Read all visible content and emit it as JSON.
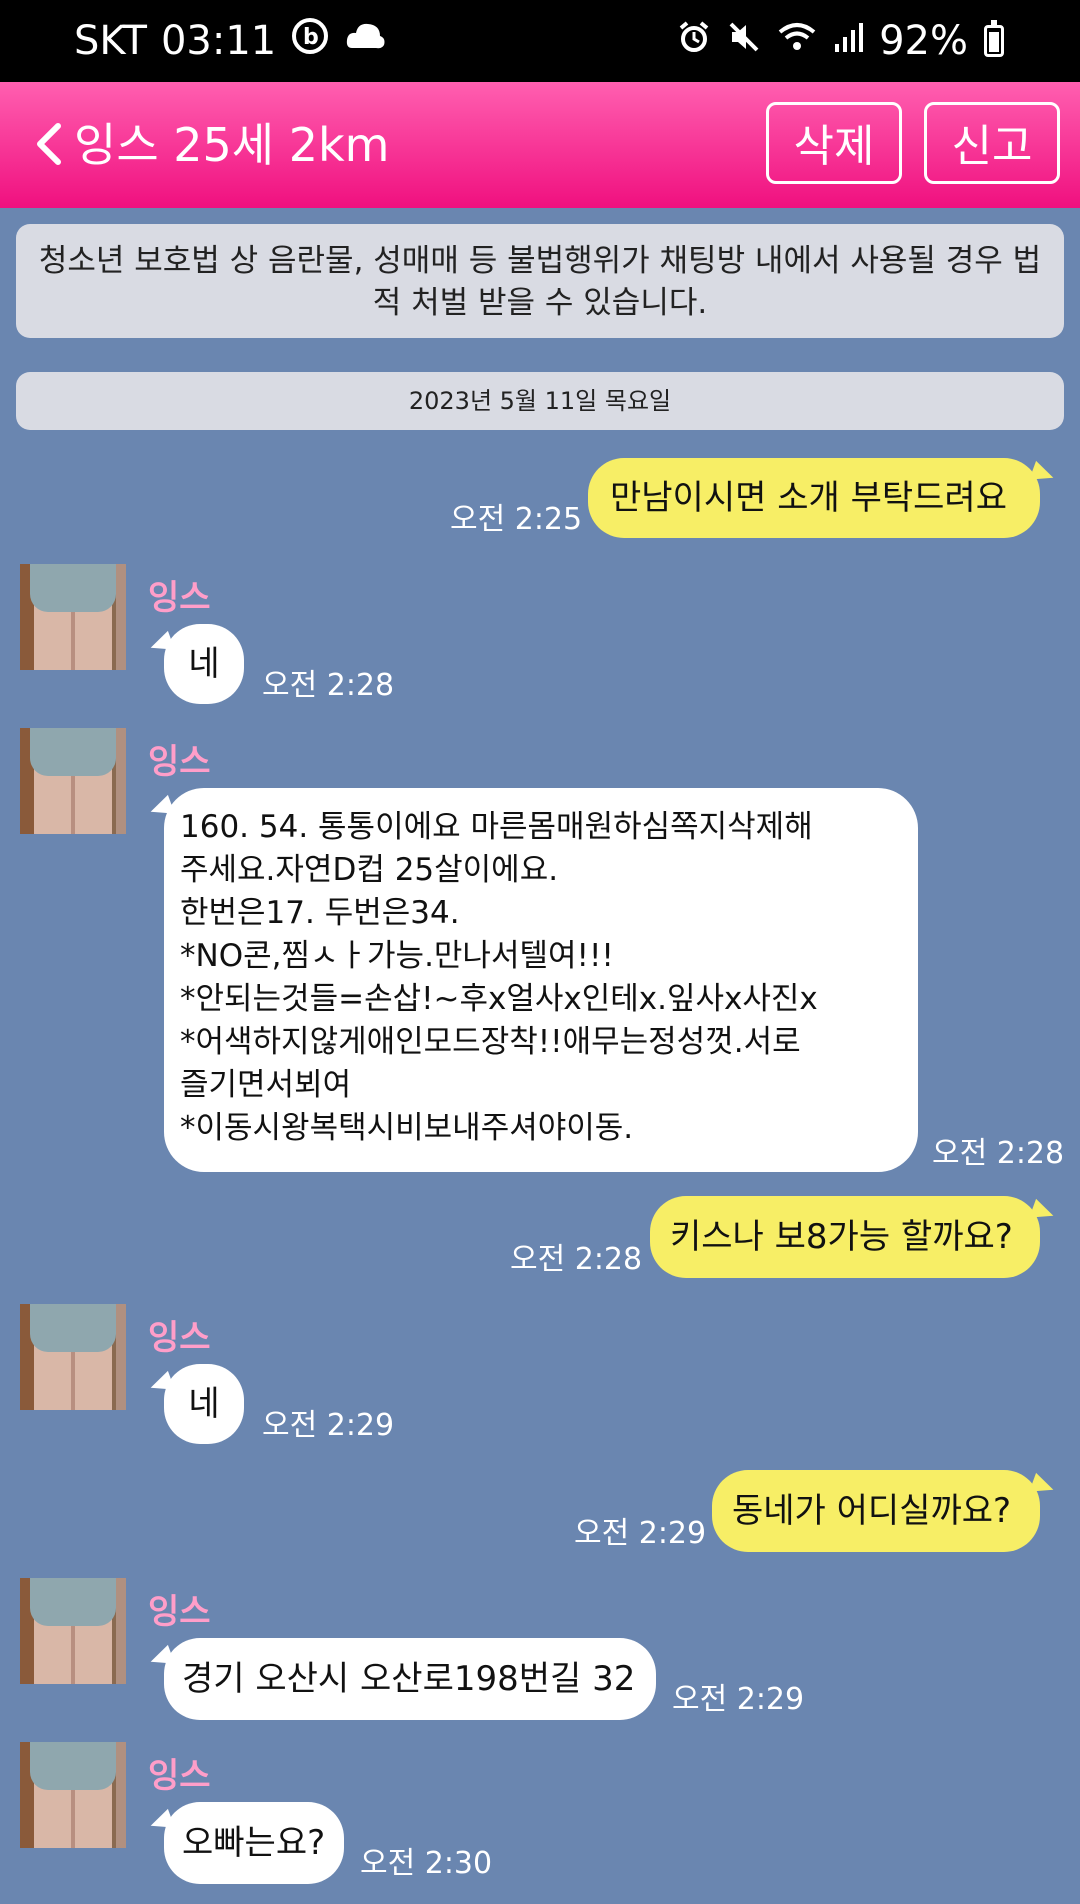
{
  "status_bar": {
    "carrier": "SKT",
    "time": "03:11",
    "battery": "92%",
    "battery_level": 0.92,
    "icons": [
      "notification-b-icon",
      "cloud-icon",
      "alarm-icon",
      "mute-icon",
      "wifi-icon",
      "signal-icon",
      "battery-icon"
    ]
  },
  "header": {
    "title": "잉스 25세 2km",
    "delete_label": "삭제",
    "report_label": "신고",
    "colors": {
      "gradient_top": "#ff5fb0",
      "gradient_bottom": "#f0107f"
    }
  },
  "notice": "청소년 보호법 상 음란물, 성매매 등 불법행위가 채팅방 내에서 사용될 경우 법적 처벌 받을 수 있습니다.",
  "date_divider": "2023년 5월 11일 목요일",
  "messages": [
    {
      "from": "me",
      "text": "만남이시면 소개 부탁드려요",
      "time": "오전 2:25"
    },
    {
      "from": "them",
      "name": "잉스",
      "text": "네",
      "time": "오전 2:28"
    },
    {
      "from": "them",
      "name": "잉스",
      "text": "160. 54. 통통이에요 마른몸매원하심쪽지삭제해\n주세요.자연D컵 25살이에요.\n한번은17. 두번은34.\n*NO콘,찜ㅅㅏ가능.만나서텔여!!!\n*안되는것들=손삽!~후x얼사x인테x.잎사x사진x\n*어색하지않게애인모드장착!!애무는정성껏.서로\n즐기면서뵈여\n*이동시왕복택시비보내주셔야이동.",
      "time": "오전 2:28"
    },
    {
      "from": "me",
      "text": "키스나 보8가능 할까요?",
      "time": "오전 2:28"
    },
    {
      "from": "them",
      "name": "잉스",
      "text": "네",
      "time": "오전 2:29"
    },
    {
      "from": "me",
      "text": "동네가 어디실까요?",
      "time": "오전 2:29"
    },
    {
      "from": "them",
      "name": "잉스",
      "text": "경기 오산시 오산로198번길 32",
      "time": "오전 2:29"
    },
    {
      "from": "them",
      "name": "잉스",
      "text": "오빠는요?",
      "time": "오전 2:30"
    }
  ],
  "colors": {
    "background": "#6a86b0",
    "my_bubble": "#f7ee66",
    "their_bubble": "#ffffff",
    "name": "#ff9ec9"
  }
}
